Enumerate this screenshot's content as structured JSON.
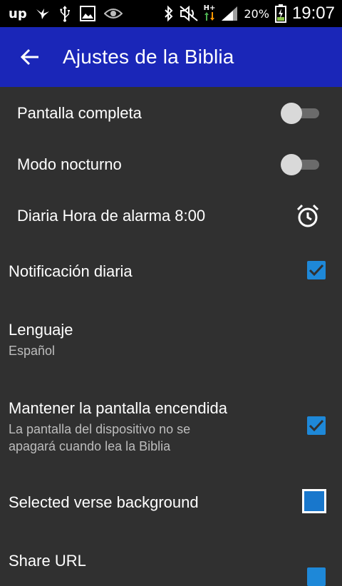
{
  "status_bar": {
    "left_icons": [
      "up-icon",
      "bird-icon",
      "usb-icon",
      "image-icon",
      "eye-icon"
    ],
    "right_icons": [
      "bluetooth-icon",
      "mute-icon",
      "hplus-data-icon",
      "signal-icon",
      "battery-charging-icon"
    ],
    "up_label": "up",
    "network_label": "H+",
    "battery": "20%",
    "time": "19:07"
  },
  "app_bar": {
    "title": "Ajustes de la Biblia"
  },
  "settings": {
    "fullscreen": {
      "label": "Pantalla completa",
      "enabled": false
    },
    "night_mode": {
      "label": "Modo nocturno",
      "enabled": false
    },
    "daily_alarm": {
      "label": "Diaria Hora de alarma 8:00"
    },
    "daily_notification": {
      "label": "Notificación diaria",
      "checked": true
    },
    "language": {
      "label": "Lenguaje",
      "value": "Español"
    },
    "keep_screen_on": {
      "label": "Mantener la pantalla encendida",
      "summary_line1": "La pantalla del dispositivo no se",
      "summary_line2": "apagará cuando lea la Biblia",
      "checked": true
    },
    "selected_verse_background": {
      "label": "Selected verse background",
      "color": "#1877cc"
    },
    "share_url": {
      "label": "Share URL",
      "checked": true
    }
  },
  "colors": {
    "app_bar": "#1a26b8",
    "background": "#303030",
    "accent": "#1e88d8"
  }
}
